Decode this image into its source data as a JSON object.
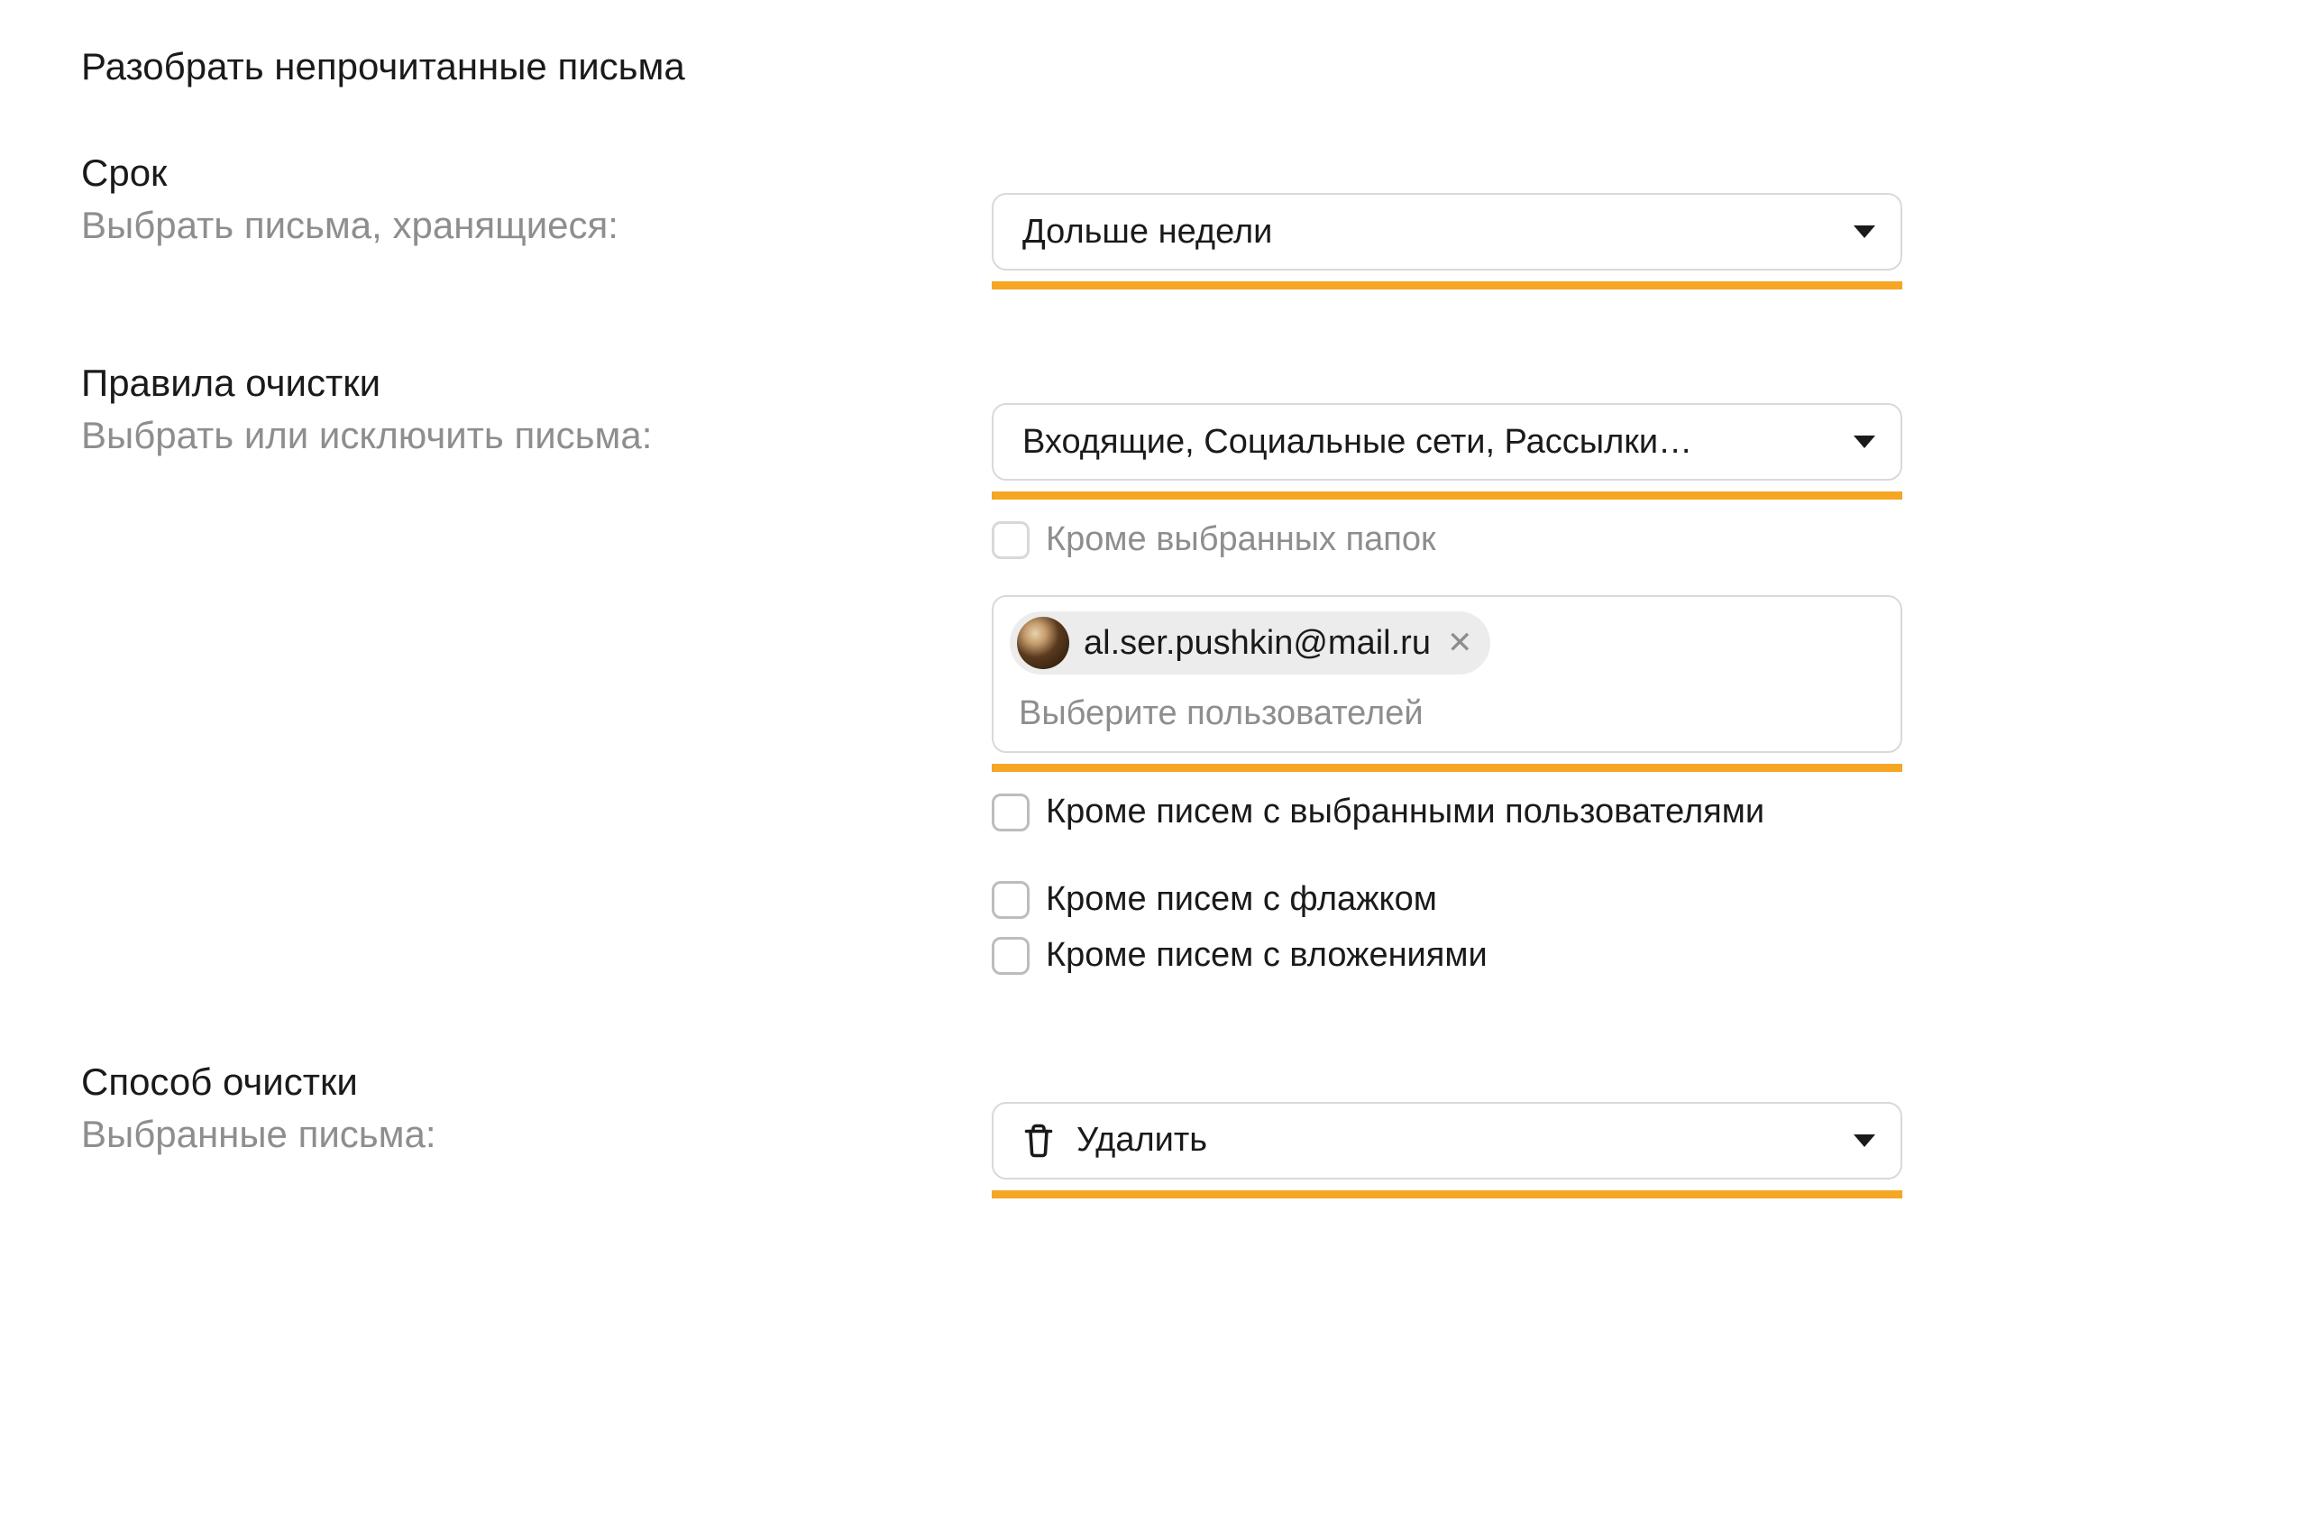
{
  "page": {
    "title": "Разобрать непрочитанные письма"
  },
  "period": {
    "heading": "Срок",
    "sub": "Выбрать письма, хранящиеся:",
    "select_value": "Дольше недели"
  },
  "rules": {
    "heading": "Правила очистки",
    "sub": "Выбрать или исключить письма:",
    "folder_select_value": "Входящие, Социальные сети, Рассылки…",
    "except_folders_label": "Кроме выбранных папок",
    "user_chip_email": "al.ser.pushkin@mail.ru",
    "user_placeholder": "Выберите пользователей",
    "except_users_label": "Кроме писем с выбранными пользователями",
    "except_flag_label": "Кроме писем с флажком",
    "except_attach_label": "Кроме писем с вложениями"
  },
  "method": {
    "heading": "Способ очистки",
    "sub": "Выбранные письма:",
    "select_value": "Удалить"
  }
}
